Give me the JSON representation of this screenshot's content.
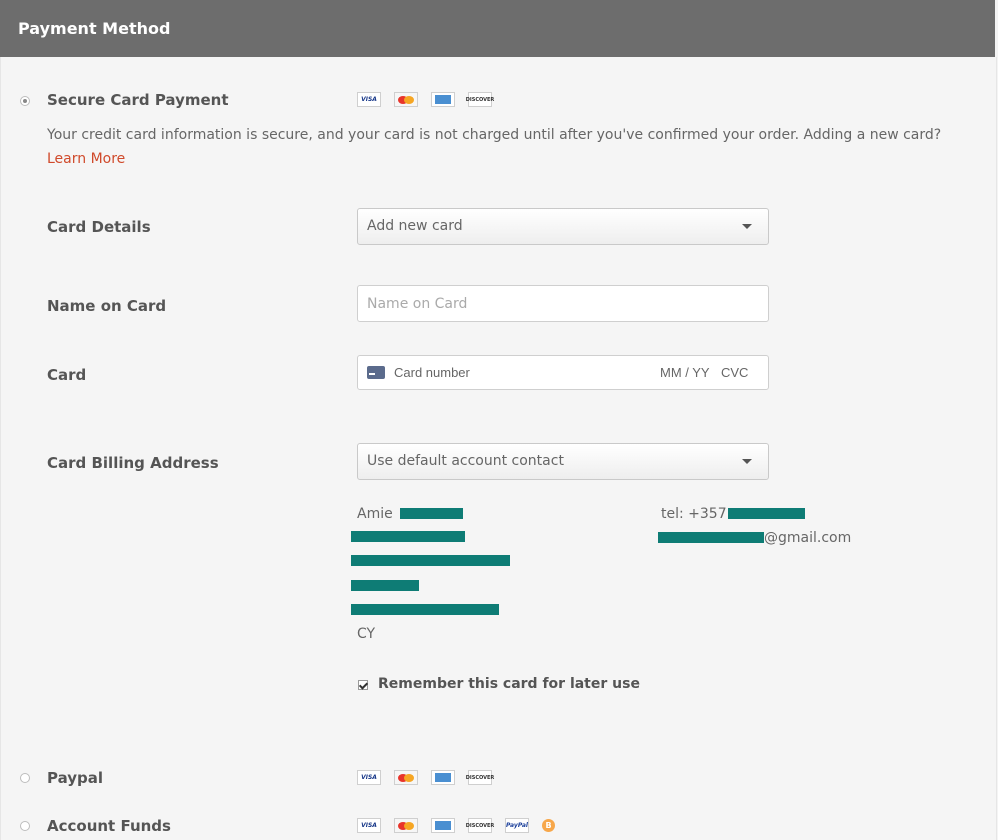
{
  "header": {
    "title": "Payment Method"
  },
  "secure": {
    "label": "Secure Card Payment",
    "info": "Your credit card information is secure, and your card is not charged until after you've confirmed your order. Adding a new card?",
    "learn_more": "Learn More",
    "card_details_label": "Card Details",
    "card_details_value": "Add new card",
    "name_label": "Name on Card",
    "name_placeholder": "Name on Card",
    "card_label": "Card",
    "card_number_placeholder": "Card number",
    "mm_yy": "MM / YY",
    "cvc": "CVC",
    "billing_label": "Card Billing Address",
    "billing_value": "Use default account contact",
    "address": {
      "name_first": "Amie",
      "country": "CY",
      "tel_prefix": "tel: +357",
      "email_suffix": "@gmail.com"
    },
    "remember_label": "Remember this card for later use"
  },
  "paypal": {
    "label": "Paypal"
  },
  "funds": {
    "label": "Account Funds"
  },
  "card_icons": {
    "visa": "VISA",
    "discover": "DISCOVER",
    "paypal": "PayPal",
    "bitcoin": "B"
  },
  "colors": {
    "header_bg": "#6d6d6d",
    "link": "#d04a2b",
    "redaction": "#0e7c75"
  }
}
